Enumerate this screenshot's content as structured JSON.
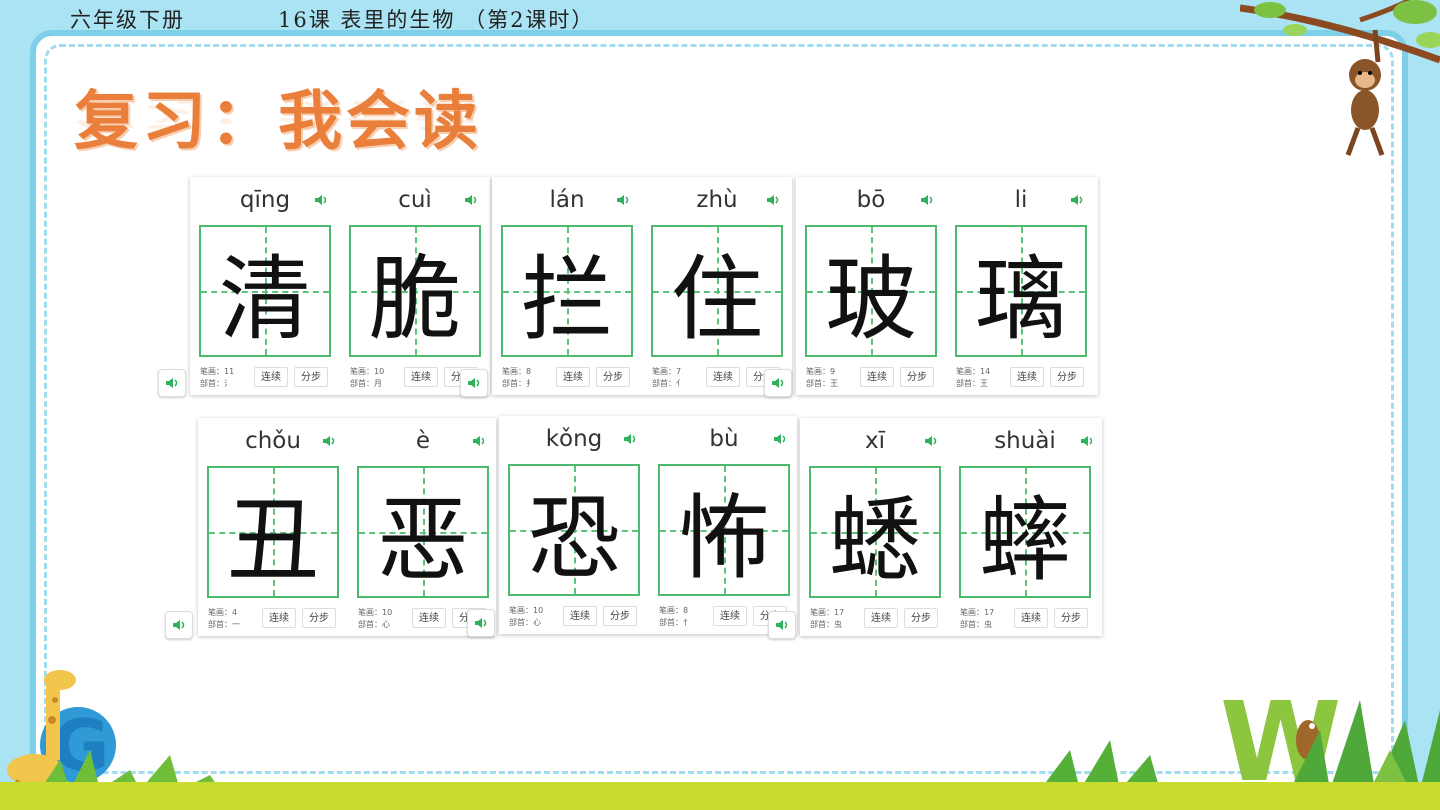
{
  "header": {
    "grade": "六年级下册",
    "lesson": "16课 表里的生物 （第2课时）"
  },
  "title": "复习：我会读",
  "stroke_label": "笔画：",
  "radical_label": "部首：",
  "btn_connect": "连续",
  "btn_step": "分步",
  "panels": [
    {
      "chars": [
        {
          "py": "qīng",
          "ch": "清",
          "strokes": "11",
          "radical": "氵"
        },
        {
          "py": "cuì",
          "ch": "脆",
          "strokes": "10",
          "radical": "月"
        }
      ]
    },
    {
      "chars": [
        {
          "py": "lán",
          "ch": "拦",
          "strokes": "8",
          "radical": "扌"
        },
        {
          "py": "zhù",
          "ch": "住",
          "strokes": "7",
          "radical": "亻"
        }
      ]
    },
    {
      "chars": [
        {
          "py": "bō",
          "ch": "玻",
          "strokes": "9",
          "radical": "王"
        },
        {
          "py": "li",
          "ch": "璃",
          "strokes": "14",
          "radical": "王"
        }
      ]
    },
    {
      "chars": [
        {
          "py": "chǒu",
          "ch": "丑",
          "strokes": "4",
          "radical": "一"
        },
        {
          "py": "è",
          "ch": "恶",
          "strokes": "10",
          "radical": "心"
        }
      ]
    },
    {
      "chars": [
        {
          "py": "kǒng",
          "ch": "恐",
          "strokes": "10",
          "radical": "心"
        },
        {
          "py": "bù",
          "ch": "怖",
          "strokes": "8",
          "radical": "忄"
        }
      ]
    },
    {
      "chars": [
        {
          "py": "xī",
          "ch": "蟋",
          "strokes": "17",
          "radical": "虫"
        },
        {
          "py": "shuài",
          "ch": "蟀",
          "strokes": "17",
          "radical": "虫"
        }
      ]
    }
  ],
  "colors": {
    "accent": "#e97f3a",
    "grid": "#4dba6e",
    "frame": "#7ecfe8",
    "speaker": "#2fb35a"
  }
}
